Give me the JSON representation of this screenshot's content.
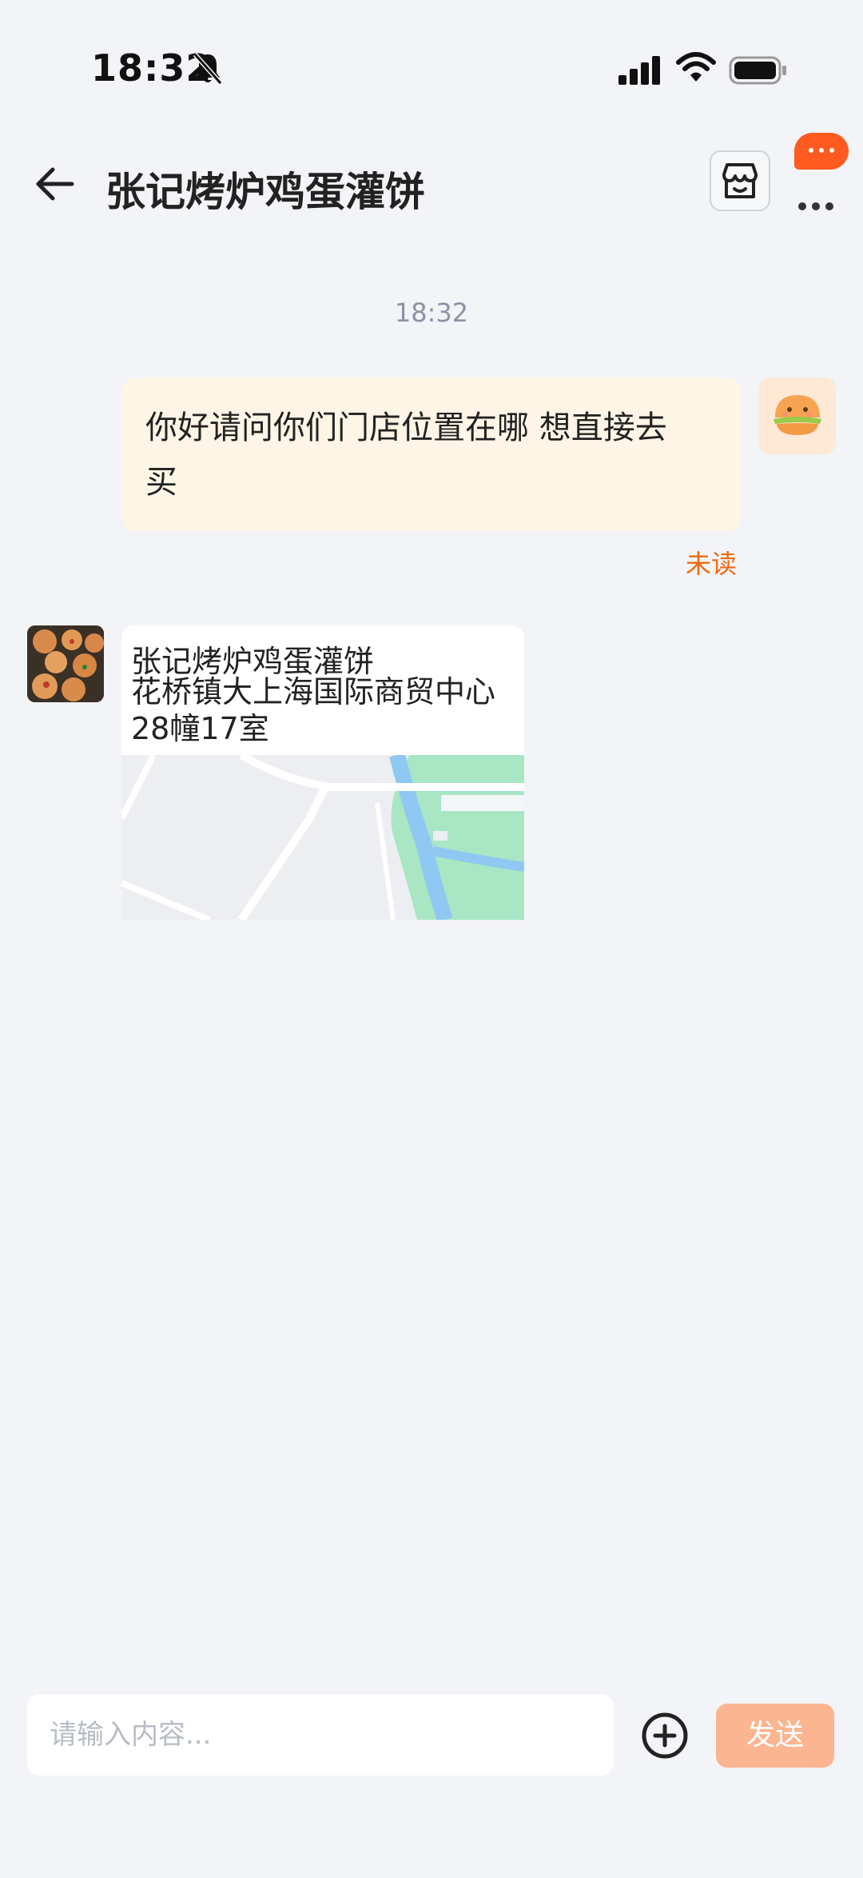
{
  "status_bar": {
    "time": "18:32",
    "icons": [
      "bell-slash-icon",
      "cellular-signal-icon",
      "wifi-icon",
      "battery-icon"
    ]
  },
  "header": {
    "title": "张记烤炉鸡蛋灌饼",
    "back_icon": "arrow-left-icon",
    "store_icon": "storefront-icon",
    "more_icon": "more-dots-icon"
  },
  "chat": {
    "timestamp": "18:32",
    "messages": [
      {
        "direction": "outgoing",
        "text_line1": "你好请问你们门店位置在哪 想直接去",
        "text_line2": "买",
        "status": "未读"
      },
      {
        "direction": "incoming",
        "type": "location",
        "name": "张记烤炉鸡蛋灌饼",
        "address": "花桥镇大上海国际商贸中心28幢17室"
      }
    ]
  },
  "input_bar": {
    "placeholder": "请输入内容...",
    "send_label": "发送"
  },
  "colors": {
    "background": "#f3f4f7",
    "outgoing_bubble": "#fff5e6",
    "unread": "#ee6a12",
    "send_button": "#fbb590",
    "badge": "#ff5a1f"
  }
}
